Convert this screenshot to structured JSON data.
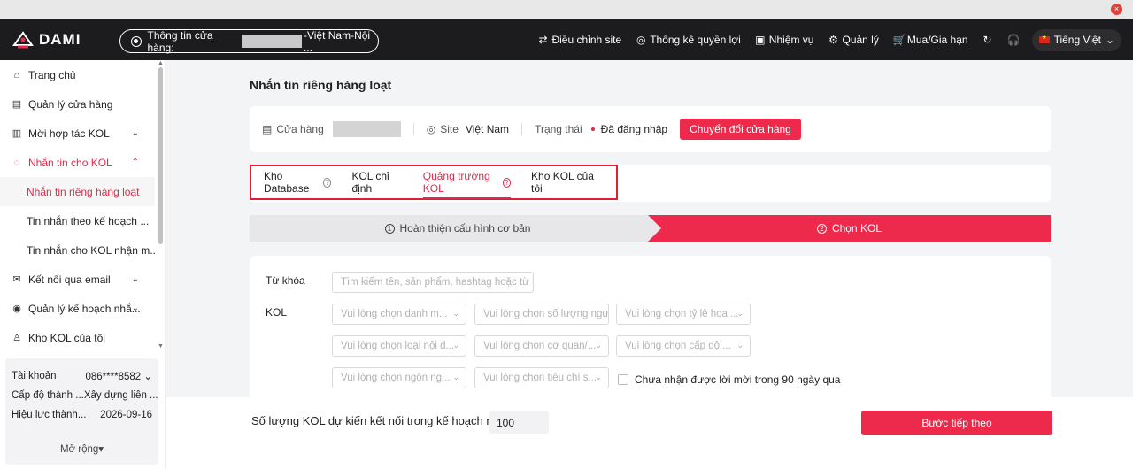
{
  "window": {
    "close_icon": "×"
  },
  "header": {
    "logo_text": "DAMI",
    "store_prefix": "Thông tin cửa hàng:",
    "store_suffix": "-Việt Nam-Nội ...",
    "nav": [
      {
        "icon": "⇄",
        "label": "Điều chỉnh site"
      },
      {
        "icon": "◎",
        "label": "Thống kê quyền lợi"
      },
      {
        "icon": "▣",
        "label": "Nhiệm vụ"
      },
      {
        "icon": "⚙",
        "label": "Quản lý"
      },
      {
        "icon": "🛒",
        "label": "Mua/Gia hạn"
      },
      {
        "icon": "↻",
        "label": ""
      },
      {
        "icon": "🎧",
        "label": ""
      }
    ],
    "language": "Tiếng Việt"
  },
  "sidebar": {
    "items": [
      {
        "icon": "⌂",
        "label": "Trang chủ"
      },
      {
        "icon": "▤",
        "label": "Quản lý cửa hàng"
      },
      {
        "icon": "▥",
        "label": "Mời hợp tác KOL"
      },
      {
        "icon": "◌",
        "label": "Nhắn tin cho KOL"
      },
      {
        "icon": "✉",
        "label": "Kết nối qua email"
      },
      {
        "icon": "◉",
        "label": "Quản lý kế hoạch nhắ..."
      },
      {
        "icon": "♙",
        "label": "Kho KOL của tôi"
      }
    ],
    "subitems": [
      {
        "label": "Nhắn tin riêng hàng loạt"
      },
      {
        "label": "Tin nhắn theo kế hoạch ..."
      },
      {
        "label": "Tin nhắn cho KOL nhận m..."
      }
    ],
    "account": {
      "rows": [
        {
          "label": "Tài khoản",
          "value": "086****8582 ⌄"
        },
        {
          "label": "Cấp độ thành ...",
          "value": "Xây dựng liên ..."
        },
        {
          "label": "Hiệu lực thành...",
          "value": "2026-09-16"
        }
      ],
      "expand": "Mở rộng"
    }
  },
  "main": {
    "title": "Nhắn tin riêng hàng loạt",
    "store": {
      "store_label": "Cửa hàng",
      "site_label": "Site",
      "site_value": "Việt Nam",
      "status_label": "Trạng thái",
      "status_value": "Đã đăng nhập",
      "switch_button": "Chuyển đổi cửa hàng"
    },
    "tabs": [
      {
        "label": "Kho Database"
      },
      {
        "label": "KOL chỉ định"
      },
      {
        "label": "Quảng trường KOL"
      },
      {
        "label": "Kho KOL của tôi"
      }
    ],
    "steps": [
      {
        "num": "1",
        "label": "Hoàn thiện cấu hình cơ bản"
      },
      {
        "num": "2",
        "label": "Chọn KOL"
      }
    ],
    "filters": {
      "keyword_label": "Từ khóa",
      "keyword_placeholder": "Tìm kiếm tên, sản phẩm, hashtag hoặc từ k...",
      "kol_label": "KOL",
      "selects": [
        "Vui lòng chọn danh m...",
        "Vui lòng chọn số lượng người",
        "Vui lòng chọn tỷ lệ hoa ...",
        "Vui lòng chọn loại nội d...",
        "Vui lòng chọn cơ quan/...",
        "Vui lòng chọn cấp độ ...",
        "Vui lòng chọn ngôn ng...",
        "Vui lòng chọn tiêu chí s..."
      ],
      "checkbox_label": "Chưa nhận được lời mời trong 90 ngày qua"
    },
    "footer": {
      "text": "Số lượng KOL dự kiến kết nối trong kế hoạch này",
      "value": "100",
      "next_button": "Bước tiếp theo"
    }
  },
  "colors": {
    "accent": "#ed2a4c",
    "header_bg": "#1c1c1e",
    "highlight_border": "#e01f36"
  }
}
